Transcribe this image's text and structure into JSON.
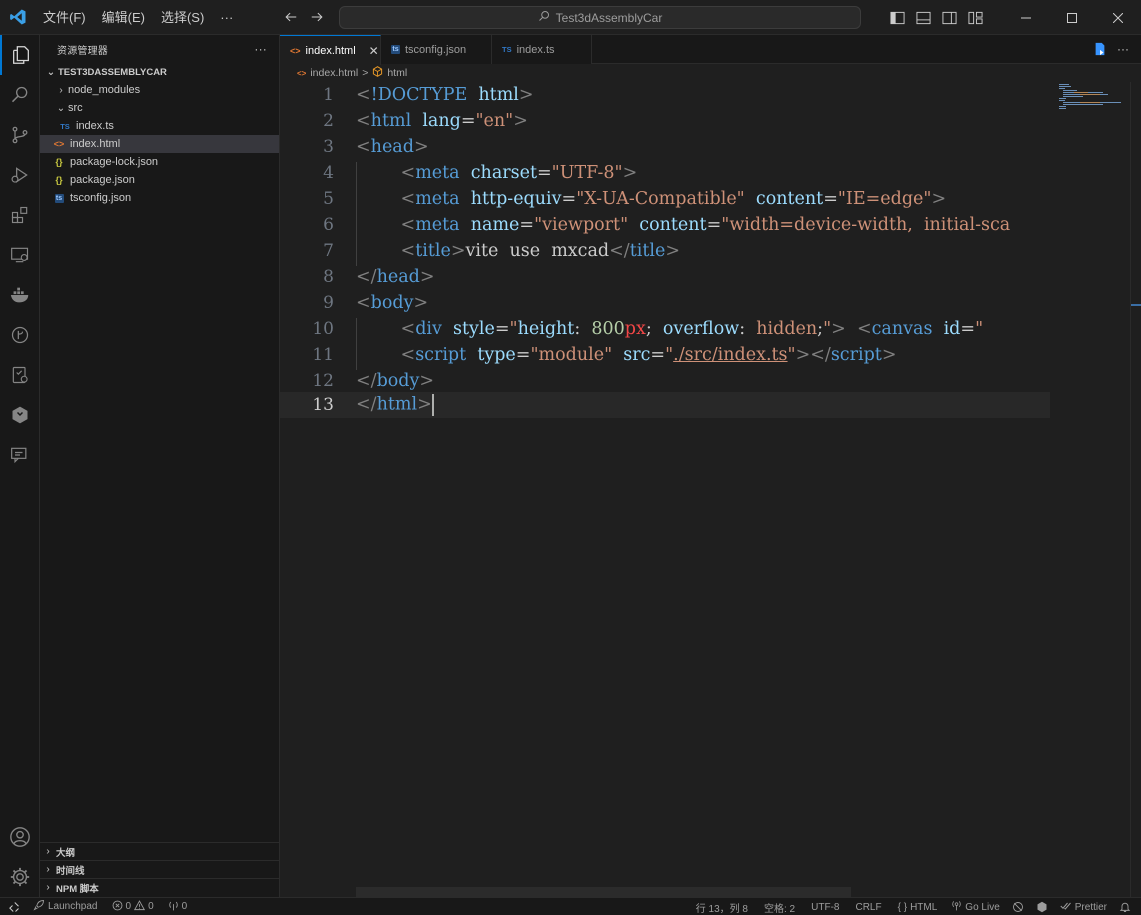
{
  "titlebar": {
    "menu": [
      "文件(F)",
      "编辑(E)",
      "选择(S)",
      "···"
    ],
    "search": "Test3dAssemblyCar"
  },
  "sidebar": {
    "title": "资源管理器",
    "more": "···",
    "root": "TEST3DASSEMBLYCAR",
    "items": [
      {
        "label": "node_modules",
        "type": "folder",
        "expanded": false
      },
      {
        "label": "src",
        "type": "folder",
        "expanded": true
      },
      {
        "label": "index.ts",
        "type": "ts"
      },
      {
        "label": "index.html",
        "type": "html",
        "selected": true
      },
      {
        "label": "package-lock.json",
        "type": "json"
      },
      {
        "label": "package.json",
        "type": "json"
      },
      {
        "label": "tsconfig.json",
        "type": "tsconfig"
      }
    ],
    "panels": [
      "大纲",
      "时间线",
      "NPM 脚本"
    ]
  },
  "tabs": [
    {
      "label": "index.html",
      "active": true,
      "icon": "html",
      "close": "✕"
    },
    {
      "label": "tsconfig.json",
      "active": false,
      "icon": "tsconfig"
    },
    {
      "label": "index.ts",
      "active": false,
      "icon": "ts"
    }
  ],
  "breadcrumb": {
    "file": "index.html",
    "element": "html",
    "separator": ">"
  },
  "editor": {
    "current_line": 13,
    "line_numbers": [
      "1",
      "2",
      "3",
      "4",
      "5",
      "6",
      "7",
      "8",
      "9",
      "10",
      "11",
      "12",
      "13"
    ]
  },
  "statusbar": {
    "launchpad": "Launchpad",
    "errors": "0",
    "warnings": "0",
    "ports": "0",
    "position": "行 13，列 8",
    "spaces": "空格: 2",
    "encoding": "UTF-8",
    "eol": "CRLF",
    "language": "HTML",
    "golive": "Go Live",
    "prettier": "Prettier"
  },
  "colors": {
    "accent": "#0078d4",
    "html": "#e37933",
    "ts": "#3178c6",
    "json": "#cbcb41"
  }
}
